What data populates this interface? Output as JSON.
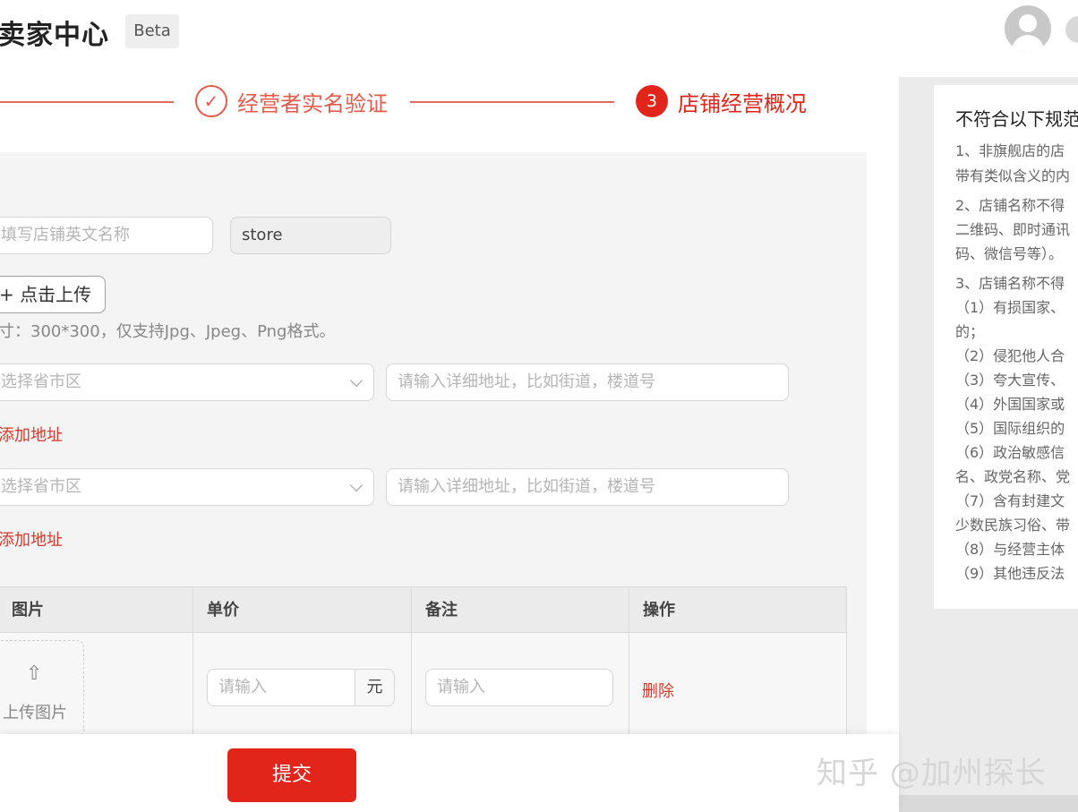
{
  "header": {
    "app_title": "卖家中心",
    "beta": "Beta"
  },
  "steps": {
    "step2_check": "✓",
    "step2_label": "经营者实名验证",
    "step3_number": "3",
    "step3_label": "店铺经营概况"
  },
  "form": {
    "english_name_placeholder": "填写店铺英文名称",
    "store_suffix": "store",
    "upload_label": "+ 点击上传",
    "upload_hint": "寸：300*300，仅支持Jpg、Jpeg、Png格式。",
    "region_placeholder": "选择省市区",
    "address_placeholder": "请输入详细地址，比如街道，楼道号",
    "add_address": "添加地址"
  },
  "table": {
    "headers": [
      "图片",
      "单价",
      "备注",
      "操作"
    ],
    "upload_image": "上传图片",
    "upload_icon": "upload-arrow",
    "price_placeholder": "请输入",
    "price_unit": "元",
    "note_placeholder": "请输入",
    "delete": "删除"
  },
  "footer": {
    "submit": "提交",
    "watermark": "知乎 @加州探长"
  },
  "rules": {
    "title": "不符合以下规范",
    "lines": [
      "1、非旗舰店的店",
      "带有类似含义的内",
      "2、店铺名称不得",
      "二维码、即时通讯",
      "码、微信号等）。",
      "3、店铺名称不得",
      "（1）有损国家、",
      "的；",
      "（2）侵犯他人合",
      "（3）夸大宣传、",
      "（4）外国国家或",
      "（5）国际组织的",
      "（6）政治敏感信",
      "名、政党名称、党",
      "（7）含有封建文",
      "少数民族习俗、带",
      "（8）与经营主体",
      "（9）其他违反法"
    ]
  },
  "colors": {
    "accent": "#e1251b",
    "step_done": "#e35b4b",
    "link": "#d43a2a"
  }
}
